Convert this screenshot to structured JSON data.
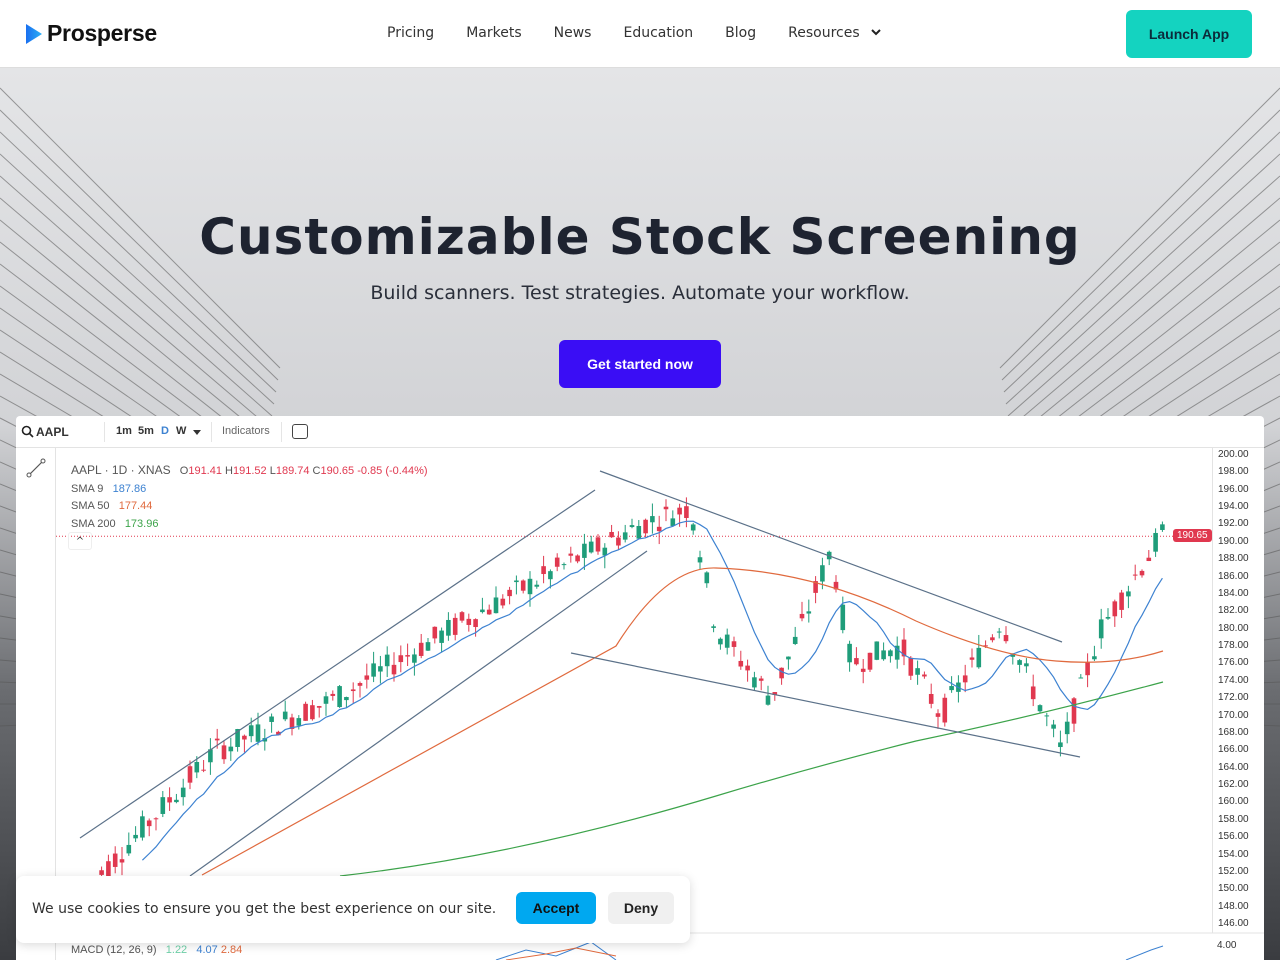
{
  "nav": {
    "brand": "Prosperse",
    "links": [
      "Pricing",
      "Markets",
      "News",
      "Education",
      "Blog",
      "Resources"
    ],
    "launch": "Launch App"
  },
  "hero": {
    "title": "Customizable Stock Screening",
    "subtitle": "Build scanners. Test strategies. Automate your workflow.",
    "cta": "Get started now"
  },
  "chart": {
    "symbol": "AAPL",
    "timeframes": [
      "1m",
      "5m",
      "D",
      "W"
    ],
    "active_timeframe": "D",
    "indicators_label": "Indicators",
    "header": "AAPL · 1D · XNAS",
    "ohlc": {
      "o": "191.41",
      "h": "191.52",
      "l": "189.74",
      "c": "190.65",
      "change": "-0.85 (-0.44%)"
    },
    "sma": [
      {
        "label": "SMA 9",
        "value": "187.86",
        "color": "#3d82d1"
      },
      {
        "label": "SMA 50",
        "value": "177.44",
        "color": "#e06a3e"
      },
      {
        "label": "SMA 200",
        "value": "173.96",
        "color": "#3ca34a"
      }
    ],
    "last_price": "190.65",
    "price_ticks": [
      "200.00",
      "198.00",
      "196.00",
      "194.00",
      "192.00",
      "190.00",
      "188.00",
      "186.00",
      "184.00",
      "182.00",
      "180.00",
      "178.00",
      "176.00",
      "174.00",
      "172.00",
      "170.00",
      "168.00",
      "166.00",
      "164.00",
      "162.00",
      "160.00",
      "158.00",
      "156.00",
      "154.00",
      "152.00",
      "150.00",
      "148.00",
      "146.00"
    ],
    "macd": {
      "label": "MACD (12, 26, 9)",
      "v1": "1.22",
      "v2": "4.07",
      "v3": "2.84",
      "tick": "4.00"
    },
    "colors": {
      "up": "#1f9d7a",
      "down": "#e0384f"
    }
  },
  "cookie": {
    "text": "We use cookies to ensure you get the best experience on our site.",
    "accept": "Accept",
    "deny": "Deny"
  }
}
